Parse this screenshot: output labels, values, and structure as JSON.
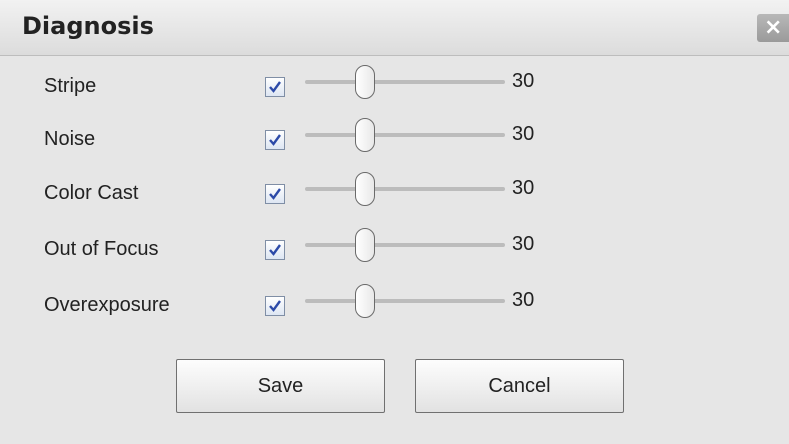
{
  "dialog": {
    "title": "Diagnosis",
    "close_label": "×"
  },
  "items": [
    {
      "label": "Stripe",
      "checked": true,
      "value": "30"
    },
    {
      "label": "Noise",
      "checked": true,
      "value": "30"
    },
    {
      "label": "Color Cast",
      "checked": true,
      "value": "30"
    },
    {
      "label": "Out of Focus",
      "checked": true,
      "value": "30"
    },
    {
      "label": "Overexposure",
      "checked": true,
      "value": "30"
    }
  ],
  "slider": {
    "min": 0,
    "max": 100
  },
  "buttons": {
    "save_label": "Save",
    "cancel_label": "Cancel"
  },
  "colors": {
    "background": "#e6e6e6",
    "checkmark": "#2c4aa8"
  }
}
